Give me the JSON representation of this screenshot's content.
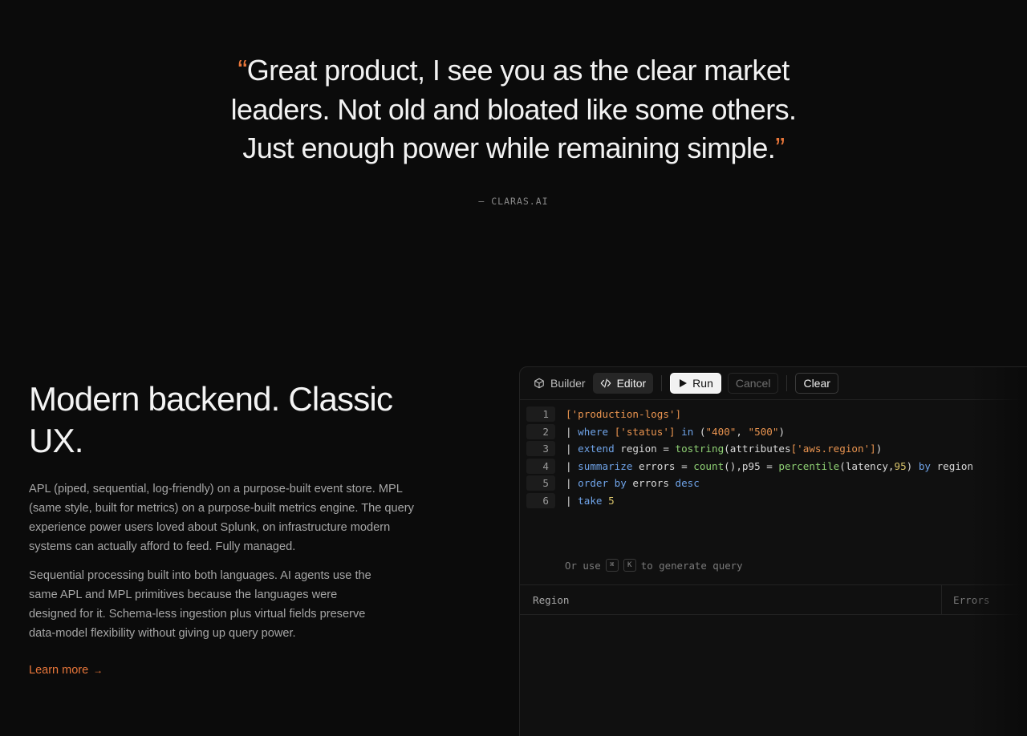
{
  "testimonial": {
    "open_quote": "“",
    "text": "Great product, I see you as the clear market leaders. Not old and bloated like some others. Just enough power while remaining simple.",
    "close_quote": "”",
    "attribution": "— CLARAS.AI"
  },
  "feature": {
    "title": "Modern backend. Classic UX.",
    "paragraph1": "APL (piped, sequential, log-friendly) on a purpose-built event store. MPL (same style, built for metrics) on a purpose-built metrics engine. The query experience power users loved about Splunk, on infrastructure modern systems can actually afford to feed. Fully managed.",
    "paragraph2": "Sequential processing built into both languages. AI agents use the same APL and MPL primitives because the languages were designed for it. Schema-less ingestion plus virtual fields preserve data-model flexibility without giving up query power.",
    "learn_more": "Learn more",
    "learn_more_arrow": "→"
  },
  "editor": {
    "tabs": [
      {
        "label": "Builder",
        "icon": "cube-icon",
        "active": false
      },
      {
        "label": "Editor",
        "icon": "code-icon",
        "active": true
      }
    ],
    "run_label": "Run",
    "cancel_label": "Cancel",
    "clear_label": "Clear",
    "line_numbers": [
      "1",
      "2",
      "3",
      "4",
      "5",
      "6"
    ],
    "code_lines": [
      "['production-logs']",
      "| where ['status'] in (\"400\", \"500\")",
      "| extend region = tostring(attributes['aws.region'])",
      "| summarize errors = count(),p95 = percentile(latency,95) by region",
      "| order by errors desc",
      "| take 5"
    ],
    "hint_prefix": "Or use",
    "hint_key1": "⌘",
    "hint_key2": "K",
    "hint_suffix": "to generate query",
    "columns": [
      "Region",
      "Errors"
    ]
  },
  "colors": {
    "accent": "#e8763a",
    "background": "#0b0b0b"
  }
}
